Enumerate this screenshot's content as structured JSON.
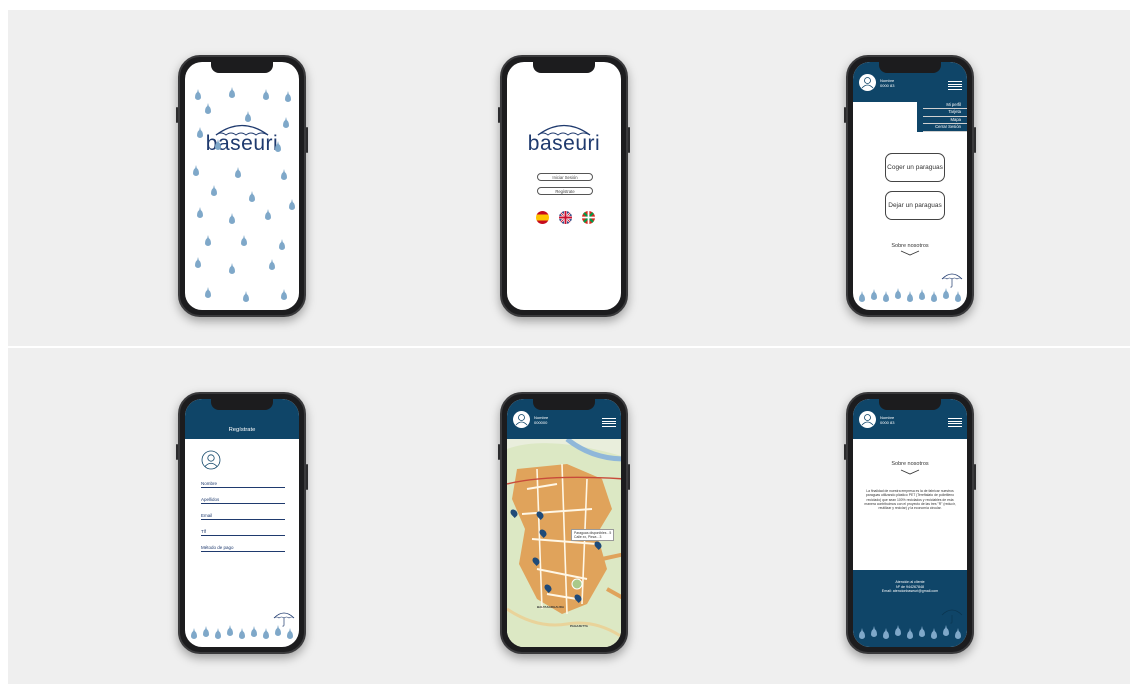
{
  "brand": {
    "name": "baseuri",
    "primary_color": "#0f4568",
    "drop_color": "#7fa8c9",
    "logo_color": "#1f3a6e"
  },
  "screen_login": {
    "buttons": [
      "Iniciar Sesión",
      "Regístrate"
    ],
    "languages": [
      "spain-flag-icon",
      "uk-flag-icon",
      "basque-flag-icon"
    ]
  },
  "user": {
    "name": "Nombre",
    "id": "0000 83"
  },
  "screen_menu": {
    "menu_items": [
      "Mi perfil",
      "Tarjeta",
      "Mapa",
      "Cerrar Sesión"
    ],
    "primary_buttons": [
      "Coger un paraguas",
      "Dejar un paraguas"
    ],
    "about_link": "Sobre nosotros"
  },
  "screen_register": {
    "title": "Regístrate",
    "fields": [
      "Nombre",
      "Apellidos",
      "Email",
      "Tlf",
      "Método de pago"
    ]
  },
  "screen_map": {
    "user_name": "Nombre",
    "user_id": "000000",
    "tooltip_line1": "Paraguas disponibles - 5",
    "tooltip_line2": "Calle xx, Pieza - 3",
    "labels": [
      "BALTASARGAURA",
      "PAGAZETTA"
    ]
  },
  "screen_about": {
    "title": "Sobre nosotros",
    "text": "La finalidad de nuestra empresa es la de fabricar nuestros paraguas utilizando plástico PET (Tereftalato de polietileno reciclado) que sean 100% reciclados y reciclables de esta manera contribuimos con el proyecto de las tres \"R\" (reducir, reutilizar y reciclar) y la economía circular.",
    "footer_title": "Atención al cliente",
    "footer_phone": "Nº de 944267848",
    "footer_email": "Email: atencionbaseuri@gmail.com"
  }
}
